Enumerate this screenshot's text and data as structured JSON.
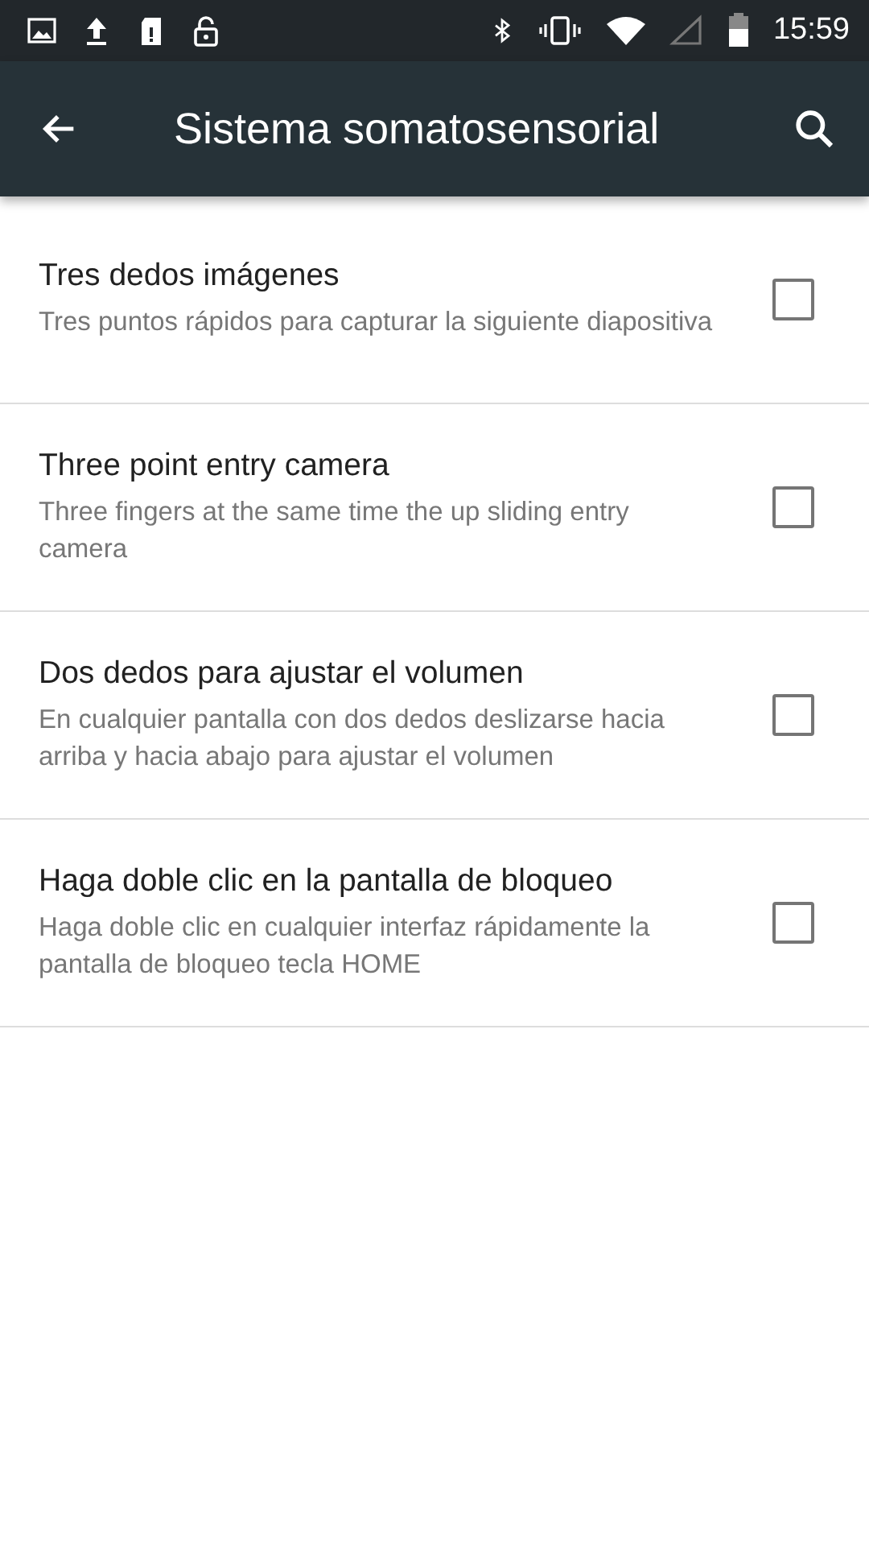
{
  "status_bar": {
    "time": "15:59"
  },
  "app_bar": {
    "title": "Sistema somatosensorial"
  },
  "settings": [
    {
      "title": "Tres dedos imágenes",
      "summary": "Tres puntos rápidos para capturar la siguiente diapositiva",
      "checked": false
    },
    {
      "title": "Three point entry camera",
      "summary": "Three fingers at the same time the up sliding entry camera",
      "checked": false
    },
    {
      "title": "Dos dedos para ajustar el volumen",
      "summary": "En cualquier pantalla con dos dedos deslizarse hacia arriba y hacia abajo para ajustar el volumen",
      "checked": false
    },
    {
      "title": "Haga doble clic en la pantalla de bloqueo",
      "summary": "Haga doble clic en cualquier interfaz rápidamente la pantalla de bloqueo tecla HOME",
      "checked": false
    }
  ]
}
